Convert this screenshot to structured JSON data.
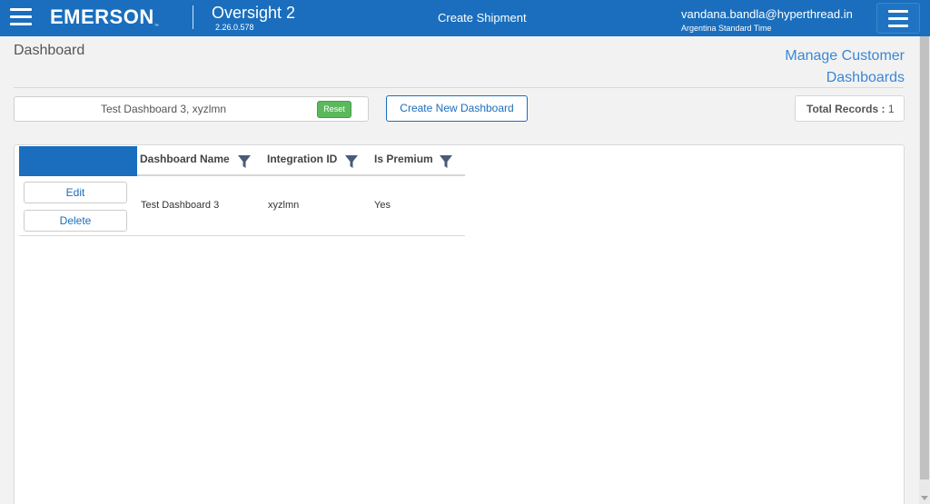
{
  "header": {
    "brand": "EMERSON",
    "app_title": "Oversight 2",
    "version": "2.26.0.578",
    "center_title": "Create Shipment",
    "user_email": "vandana.bandla@hyperthread.in",
    "timezone": "Argentina Standard Time",
    "brand_color": "#1a6ebd"
  },
  "page": {
    "title": "Dashboard",
    "manage_link_line1": "Manage Customer",
    "manage_link_line2": "Dashboards"
  },
  "toolbar": {
    "search_value": "Test Dashboard 3, xyzlmn",
    "reset_label": "Reset",
    "create_label": "Create New Dashboard",
    "total_label": "Total Records :",
    "total_value": "1"
  },
  "grid": {
    "columns": [
      "Dashboard Name",
      "Integration ID",
      "Is Premium"
    ],
    "rows": [
      {
        "edit_label": "Edit",
        "delete_label": "Delete",
        "name": "Test Dashboard 3",
        "integration_id": "xyzlmn",
        "is_premium": "Yes"
      }
    ]
  },
  "icons": [
    "menu-icon",
    "filter-icon"
  ]
}
